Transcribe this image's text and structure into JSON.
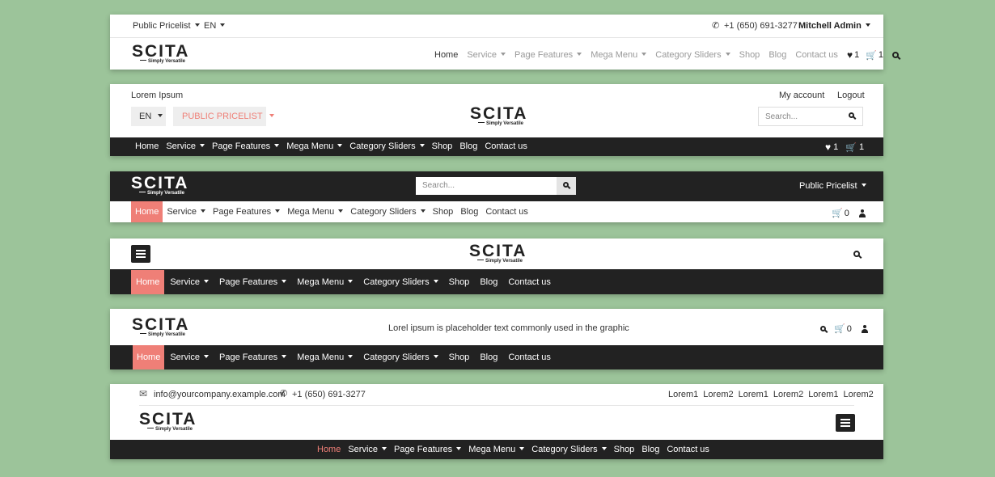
{
  "brand": {
    "logo_word": "SCITA",
    "logo_tagline": "Simply Versatile"
  },
  "header1": {
    "pricelist": "Public Pricelist",
    "lang": "EN",
    "phone": "+1 (650) 691-3277",
    "user": "Mitchell Admin",
    "nav": [
      "Home",
      "Service",
      "Page Features",
      "Mega Menu",
      "Category Sliders",
      "Shop",
      "Blog",
      "Contact us"
    ],
    "wishlist_count": "1",
    "cart_count": "1"
  },
  "header2": {
    "lorem": "Lorem Ipsum",
    "my_account": "My account",
    "logout": "Logout",
    "lang": "EN",
    "pricelist": "PUBLIC PRICELIST",
    "search_placeholder": "Search...",
    "nav": [
      "Home",
      "Service",
      "Page Features",
      "Mega Menu",
      "Category Sliders",
      "Shop",
      "Blog",
      "Contact us"
    ],
    "wishlist_count": "1",
    "cart_count": "1"
  },
  "header3": {
    "search_placeholder": "Search...",
    "pricelist": "Public Pricelist",
    "nav": [
      "Home",
      "Service",
      "Page Features",
      "Mega Menu",
      "Category Sliders",
      "Shop",
      "Blog",
      "Contact us"
    ],
    "cart_count": "0"
  },
  "header4": {
    "nav": [
      "Home",
      "Service",
      "Page Features",
      "Mega Menu",
      "Category Sliders",
      "Shop",
      "Blog",
      "Contact us"
    ]
  },
  "header5": {
    "tagline": "Lorel ipsum is placeholder text commonly used in the graphic",
    "cart_count": "0",
    "nav": [
      "Home",
      "Service",
      "Page Features",
      "Mega Menu",
      "Category Sliders",
      "Shop",
      "Blog",
      "Contact us"
    ]
  },
  "header6": {
    "email": "info@yourcompany.example.com",
    "phone": "+1 (650) 691-3277",
    "links": [
      "Lorem1",
      "Lorem2",
      "Lorem1",
      "Lorem2",
      "Lorem1",
      "Lorem2"
    ],
    "nav": [
      "Home",
      "Service",
      "Page Features",
      "Mega Menu",
      "Category Sliders",
      "Shop",
      "Blog",
      "Contact us"
    ]
  },
  "colors": {
    "accent": "#ef7f77",
    "dark": "#222222",
    "background": "#9cc49a"
  }
}
